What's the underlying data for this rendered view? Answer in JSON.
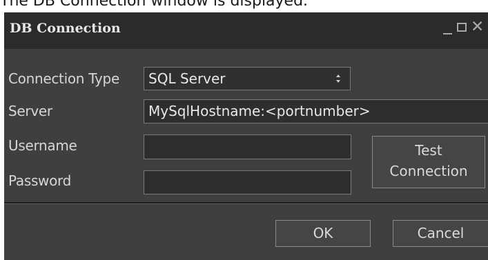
{
  "caption": "The DB Connection window is displayed.",
  "window": {
    "title": "DB Connection",
    "controls": {
      "minimize": "_",
      "close": "✕"
    }
  },
  "form": {
    "connection_type_label": "Connection Type",
    "connection_type_value": "SQL Server",
    "server_label": "Server",
    "server_value": "MySqlHostname:<portnumber>",
    "username_label": "Username",
    "username_value": "",
    "password_label": "Password",
    "password_value": ""
  },
  "buttons": {
    "test_line1": "Test",
    "test_line2": "Connection",
    "ok": "OK",
    "cancel": "Cancel"
  },
  "colors": {
    "window_bg": "#3f3f3f",
    "titlebar_bg": "#2b2b2b",
    "text": "#d6d6d6"
  }
}
